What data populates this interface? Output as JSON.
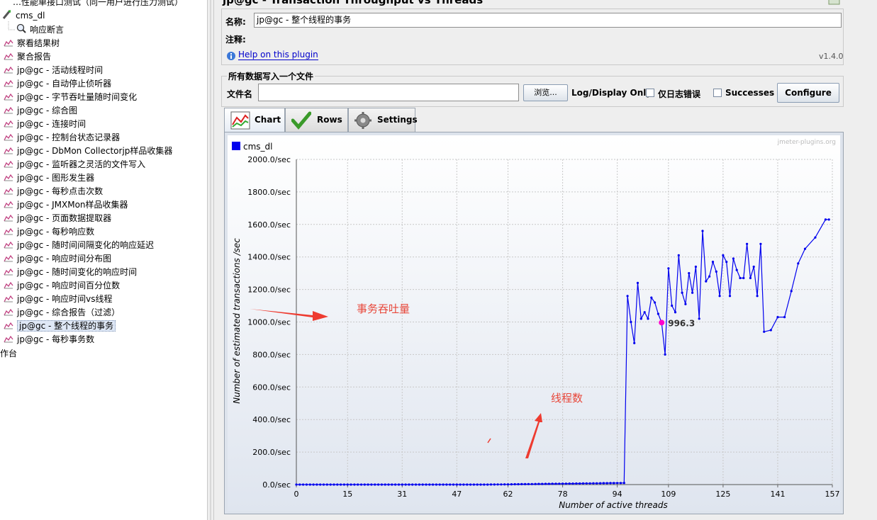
{
  "tree": {
    "top_partial": "…性能单接口测试（同一用户进行压力测试）",
    "items": [
      {
        "label": "cms_dl",
        "x": 25,
        "y": 13,
        "icon": "sampler-icon"
      },
      {
        "label": "响应断言",
        "x": 45,
        "y": 33,
        "icon": "magnifier-icon"
      },
      {
        "label": "察看结果树",
        "x": 25,
        "y": 52,
        "icon": "chart-icon"
      },
      {
        "label": "聚合报告",
        "x": 25,
        "y": 71,
        "icon": "chart-icon"
      },
      {
        "label": "jp@gc - 活动线程时间",
        "x": 25,
        "y": 90,
        "icon": "chart-icon"
      },
      {
        "label": "jp@gc - 自动停止侦听器",
        "x": 25,
        "y": 109,
        "icon": "chart-icon"
      },
      {
        "label": "jp@gc - 字节吞吐量随时间变化",
        "x": 25,
        "y": 128,
        "icon": "chart-icon"
      },
      {
        "label": "jp@gc - 综合图",
        "x": 25,
        "y": 147,
        "icon": "chart-icon"
      },
      {
        "label": "jp@gc - 连接时间",
        "x": 25,
        "y": 166,
        "icon": "chart-icon"
      },
      {
        "label": "jp@gc - 控制台状态记录器",
        "x": 25,
        "y": 185,
        "icon": "chart-icon"
      },
      {
        "label": "jp@gc - DbMon Collectorjp样品收集器",
        "x": 25,
        "y": 204,
        "icon": "chart-icon"
      },
      {
        "label": "jp@gc - 监听器之灵活的文件写入",
        "x": 25,
        "y": 223,
        "icon": "chart-icon"
      },
      {
        "label": "jp@gc - 图形发生器",
        "x": 25,
        "y": 242,
        "icon": "chart-icon"
      },
      {
        "label": "jp@gc - 每秒点击次数",
        "x": 25,
        "y": 261,
        "icon": "chart-icon"
      },
      {
        "label": "jp@gc - JMXMon样品收集器",
        "x": 25,
        "y": 280,
        "icon": "chart-icon"
      },
      {
        "label": "jp@gc - 页面数据提取器",
        "x": 25,
        "y": 299,
        "icon": "chart-icon"
      },
      {
        "label": "jp@gc - 每秒响应数",
        "x": 25,
        "y": 318,
        "icon": "chart-icon"
      },
      {
        "label": "jp@gc - 随时间间隔变化的响应延迟",
        "x": 25,
        "y": 337,
        "icon": "chart-icon"
      },
      {
        "label": "jp@gc - 响应时间分布图",
        "x": 25,
        "y": 356,
        "icon": "chart-icon"
      },
      {
        "label": "jp@gc - 随时间变化的响应时间",
        "x": 25,
        "y": 375,
        "icon": "chart-icon"
      },
      {
        "label": "jp@gc - 响应时间百分位数",
        "x": 25,
        "y": 394,
        "icon": "chart-icon"
      },
      {
        "label": "jp@gc - 响应时间vs线程",
        "x": 25,
        "y": 413,
        "icon": "chart-icon"
      },
      {
        "label": "jp@gc - 综合报告（过滤）",
        "x": 25,
        "y": 432,
        "icon": "chart-icon"
      },
      {
        "label": "jp@gc - 整个线程的事务",
        "x": 25,
        "y": 451,
        "icon": "chart-icon",
        "selected": true
      },
      {
        "label": "jp@gc - 每秒事务数",
        "x": 25,
        "y": 470,
        "icon": "chart-icon"
      }
    ],
    "bottom_partial": "作台"
  },
  "panel": {
    "title": "jp@gc - Transaction Throughput vs Threads",
    "name_label": "名称:",
    "name_value": "jp@gc - 整个线程的事务",
    "comment_label": "注释:",
    "help_link": "Help on this plugin",
    "version": "v1.4.0",
    "file_group_title": "所有数据写入一个文件",
    "filename_label": "文件名",
    "browse_button": "浏览...",
    "log_display_label": "Log/Display Only:",
    "errors_only_label": "仅日志错误",
    "successes_label": "Successes",
    "configure_button": "Configure",
    "tabs": {
      "chart": "Chart",
      "rows": "Rows",
      "settings": "Settings"
    },
    "annotations": {
      "throughput": "事务吞吐量",
      "threads": "线程数"
    }
  },
  "colors": {
    "series": "#0000ee",
    "highlight": "#ff00cc",
    "annotation": "#e8473a",
    "arrow": "#ee3b30"
  },
  "chart_data": {
    "type": "line",
    "watermark": "jmeter-plugins.org",
    "xlabel": "Number of active threads",
    "ylabel": "Number of estimated transactions /sec",
    "xlim": [
      0,
      157
    ],
    "ylim": [
      0,
      2000
    ],
    "x_ticks": [
      0,
      15,
      31,
      47,
      62,
      78,
      94,
      109,
      125,
      141,
      157
    ],
    "y_ticks": [
      {
        "v": 0,
        "label": "0.0/sec"
      },
      {
        "v": 200,
        "label": "200.0/sec"
      },
      {
        "v": 400,
        "label": "400.0/sec"
      },
      {
        "v": 600,
        "label": "600.0/sec"
      },
      {
        "v": 800,
        "label": "800.0/sec"
      },
      {
        "v": 1000,
        "label": "1000.0/sec"
      },
      {
        "v": 1200,
        "label": "1200.0/sec"
      },
      {
        "v": 1400,
        "label": "1400.0/sec"
      },
      {
        "v": 1600,
        "label": "1600.0/sec"
      },
      {
        "v": 1800,
        "label": "1800.0/sec"
      },
      {
        "v": 2000,
        "label": "2000.0/sec"
      }
    ],
    "legend": "top-left",
    "grid": true,
    "series": [
      {
        "name": "cms_dl",
        "x": [
          97,
          98,
          99,
          100,
          101,
          102,
          103,
          104,
          105,
          106,
          107,
          108,
          109,
          110,
          111,
          112,
          113,
          114,
          115,
          116,
          117,
          118,
          119,
          120,
          121,
          122,
          123,
          124,
          125,
          126,
          127,
          128,
          129,
          130,
          131,
          132,
          133,
          134,
          135,
          136,
          137,
          139,
          141,
          143,
          145,
          147,
          149,
          152,
          155,
          156
        ],
        "y": [
          1160,
          1000,
          870,
          1240,
          1020,
          1060,
          1020,
          1150,
          1120,
          1050,
          996.3,
          800,
          1330,
          1100,
          1060,
          1410,
          1180,
          1110,
          1300,
          1180,
          1340,
          1020,
          1560,
          1250,
          1280,
          1370,
          1310,
          1160,
          1410,
          1370,
          1160,
          1390,
          1320,
          1270,
          1270,
          1480,
          1270,
          1340,
          1160,
          1480,
          940,
          950,
          1030,
          1030,
          1190,
          1360,
          1450,
          1520,
          1630,
          1630
        ]
      }
    ],
    "ramp": {
      "x_start": 0,
      "x_end": 96,
      "y_start": 0,
      "y_end": 20
    },
    "highlight": {
      "x": 107,
      "y": 996.3,
      "label": "996.3"
    }
  }
}
